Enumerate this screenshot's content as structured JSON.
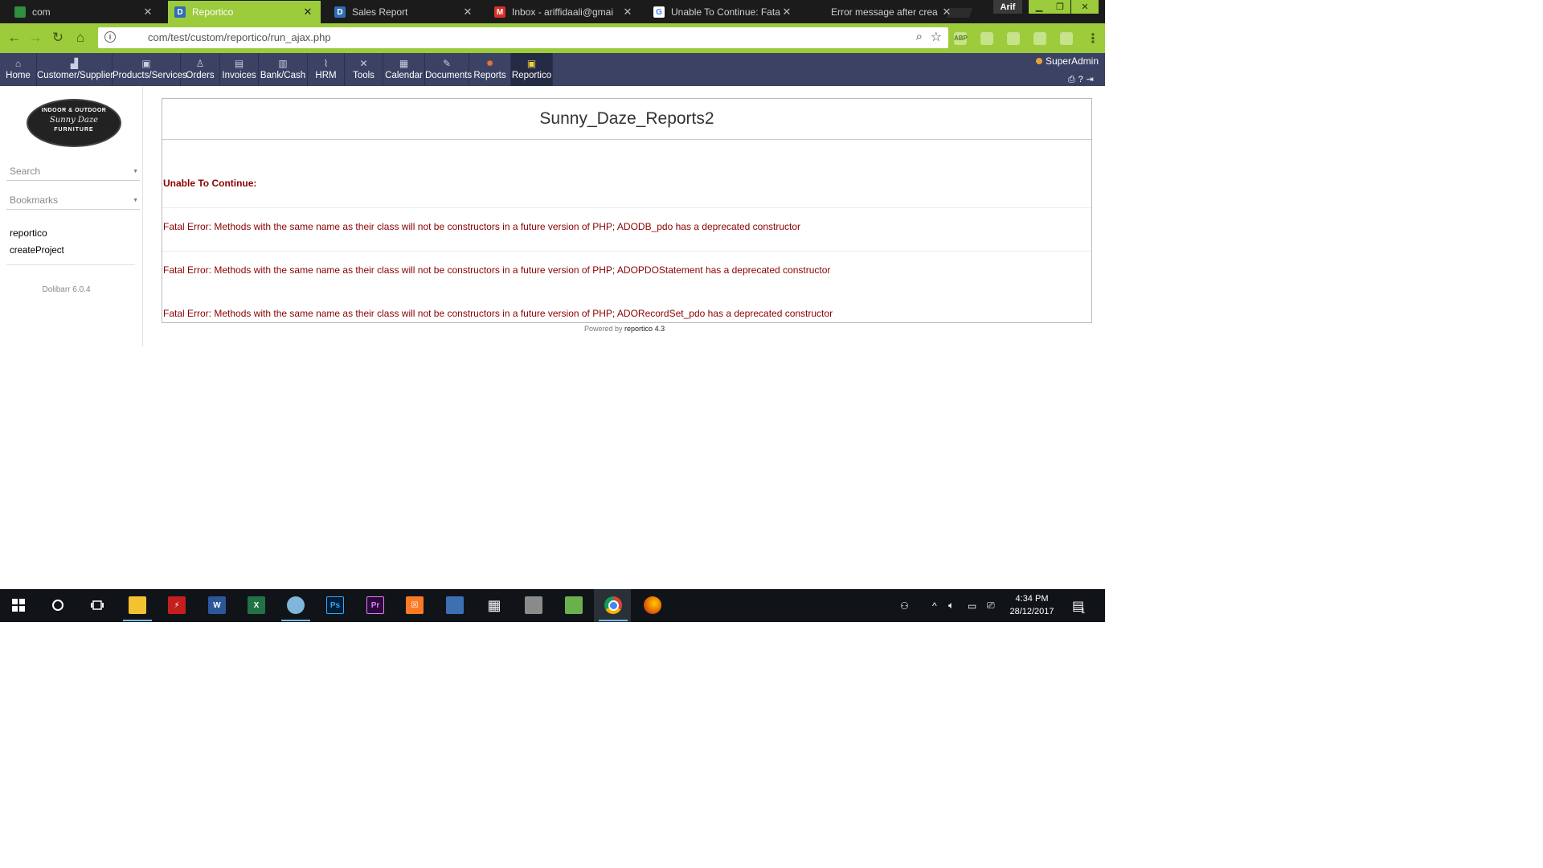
{
  "browser": {
    "tabs": [
      {
        "title": "com",
        "favicon": "globe-icon",
        "color": "#2f8f3f",
        "active": false
      },
      {
        "title": "Reportico",
        "favicon": "D",
        "color": "#2f6db5",
        "active": true
      },
      {
        "title": "Sales Report",
        "favicon": "D",
        "color": "#2f6db5",
        "active": false
      },
      {
        "title": "Inbox - ariffidaali@gmai",
        "favicon": "M",
        "color": "#d93025",
        "active": false
      },
      {
        "title": "Unable To Continue: Fata",
        "favicon": "G",
        "color": "#ffffff",
        "active": false
      },
      {
        "title": "Error message after crea",
        "favicon": "",
        "color": "#1b1b1b",
        "active": false
      }
    ],
    "profile_name": "Arif",
    "url": "com/test/custom/reportico/run_ajax.php",
    "extensions": [
      "ABP",
      "",
      "",
      "",
      ""
    ]
  },
  "app": {
    "menu": [
      {
        "label": "Home",
        "icon": "home-icon"
      },
      {
        "label": "Customer/Supplier",
        "icon": "company-icon"
      },
      {
        "label": "Products/Services",
        "icon": "products-icon"
      },
      {
        "label": "Orders",
        "icon": "orders-icon"
      },
      {
        "label": "Invoices",
        "icon": "invoices-icon"
      },
      {
        "label": "Bank/Cash",
        "icon": "bank-icon"
      },
      {
        "label": "HRM",
        "icon": "hrm-icon"
      },
      {
        "label": "Tools",
        "icon": "tools-icon"
      },
      {
        "label": "Calendar",
        "icon": "calendar-icon"
      },
      {
        "label": "Documents",
        "icon": "documents-icon"
      },
      {
        "label": "Reports",
        "icon": "reports-icon"
      },
      {
        "label": "Reportico",
        "icon": "reportico-icon"
      }
    ],
    "user": "SuperAdmin"
  },
  "sidebar": {
    "logo": {
      "line1": "INDOOR & OUTDOOR",
      "line2": "Sunny Daze",
      "line3": "FURNITURE"
    },
    "search_placeholder": "Search",
    "bookmarks_placeholder": "Bookmarks",
    "links": [
      "reportico",
      "createProject"
    ],
    "version": "Dolibarr 6.0.4"
  },
  "report": {
    "title": "Sunny_Daze_Reports2",
    "error_heading": "Unable To Continue:",
    "errors": [
      "Fatal Error: Methods with the same name as their class will not be constructors in a future version of PHP; ADODB_pdo has a deprecated constructor",
      "Fatal Error: Methods with the same name as their class will not be constructors in a future version of PHP; ADOPDOStatement has a deprecated constructor",
      "Fatal Error: Methods with the same name as their class will not be constructors in a future version of PHP; ADORecordSet_pdo has a deprecated constructor"
    ],
    "powered_prefix": "Powered by",
    "powered_brand": "reportico 4.3"
  },
  "taskbar": {
    "apps": [
      {
        "name": "file-explorer-icon",
        "glyph": "",
        "color": "#f2c230"
      },
      {
        "name": "flash-icon",
        "glyph": "⚡",
        "color": "#c41e1e"
      },
      {
        "name": "word-icon",
        "glyph": "W",
        "color": "#2b579a"
      },
      {
        "name": "excel-icon",
        "glyph": "X",
        "color": "#217346"
      },
      {
        "name": "paint-icon",
        "glyph": "",
        "color": "#7fb6d9"
      },
      {
        "name": "photoshop-icon",
        "glyph": "Ps",
        "color": "#001d34"
      },
      {
        "name": "premiere-icon",
        "glyph": "Pr",
        "color": "#2a0a3a"
      },
      {
        "name": "xampp-icon",
        "glyph": "☒",
        "color": "#fb7a24"
      },
      {
        "name": "network-icon",
        "glyph": "",
        "color": "#3d6fb3"
      },
      {
        "name": "calculator-icon",
        "glyph": "▦",
        "color": "#101418"
      },
      {
        "name": "file-manager-icon",
        "glyph": "",
        "color": "#8a8a8a"
      },
      {
        "name": "notepad-icon",
        "glyph": "",
        "color": "#6ab04c"
      },
      {
        "name": "chrome-icon",
        "glyph": "",
        "color": "#e8e8e8"
      },
      {
        "name": "firefox-icon",
        "glyph": "",
        "color": "#e66000"
      }
    ],
    "time": "4:34 PM",
    "date": "28/12/2017",
    "notification_count": "1"
  }
}
